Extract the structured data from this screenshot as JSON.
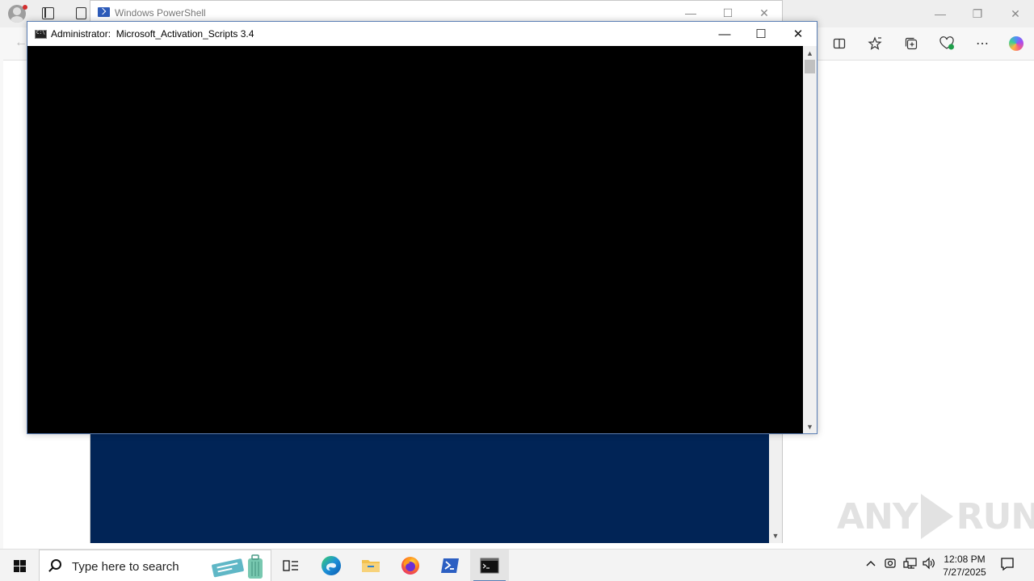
{
  "browser": {
    "name": "Microsoft Edge",
    "window_controls": {
      "minimize": "—",
      "restore": "❐",
      "close": "✕"
    }
  },
  "powershell": {
    "title": "Windows PowerShell",
    "controls": {
      "minimize": "—",
      "maximize": "☐",
      "close": "✕"
    },
    "bg_color": "#012456"
  },
  "console": {
    "title_prefix": "Administrator:",
    "title_name": "Microsoft_Activation_Scripts 3.4",
    "controls": {
      "minimize": "—",
      "maximize": "☐",
      "close": "✕"
    },
    "bg_color": "#000000"
  },
  "watermark": {
    "left": "ANY",
    "right": "RUN"
  },
  "taskbar": {
    "search_placeholder": "Type here to search",
    "apps": [
      "task-view",
      "edge",
      "file-explorer",
      "firefox",
      "powershell",
      "cmd"
    ],
    "clock_time": "12:08 PM",
    "clock_date": "7/27/2025"
  }
}
